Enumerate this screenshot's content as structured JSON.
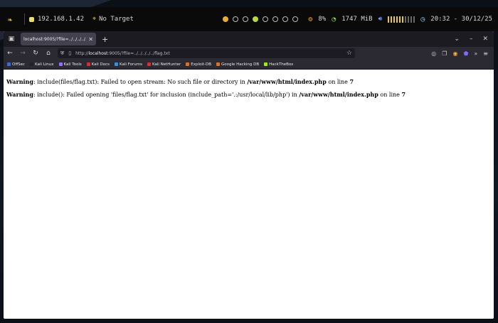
{
  "topbar": {
    "ip": "192.168.1.42",
    "target": "No Target",
    "cpu": "8%",
    "memory": "1747 MiB",
    "time": "20:32 - 30/12/25"
  },
  "tab": {
    "title": "localhost:9005/?file=../../../../.."
  },
  "url": {
    "prefix": "http://",
    "host": "localhost",
    "rest": ":9005/?file=../../../../../flag.txt"
  },
  "bookmarks": [
    {
      "label": "OffSec",
      "color": "#3a6bd8"
    },
    {
      "label": "Kali Linux",
      "color": "#222222"
    },
    {
      "label": "Kali Tools",
      "color": "#9a6bff"
    },
    {
      "label": "Kali Docs",
      "color": "#d83030"
    },
    {
      "label": "Kali Forums",
      "color": "#3a8bd8"
    },
    {
      "label": "Kali NetHunter",
      "color": "#d83030"
    },
    {
      "label": "Exploit-DB",
      "color": "#e07020"
    },
    {
      "label": "Google Hacking DB",
      "color": "#e07020"
    },
    {
      "label": "HackTheBox",
      "color": "#9fef00"
    }
  ],
  "warnings": [
    {
      "label": "Warning",
      "text1": ": include(files/flag.txt): Failed to open stream: No such file or directory in ",
      "path": "/var/www/html/index.php",
      "text2": " on line ",
      "line": "7"
    },
    {
      "label": "Warning",
      "text1": ": include(): Failed opening 'files/flag.txt' for inclusion (include_path='.:/usr/local/lib/php') in ",
      "path": "/var/www/html/index.php",
      "text2": " on line ",
      "line": "7"
    }
  ]
}
